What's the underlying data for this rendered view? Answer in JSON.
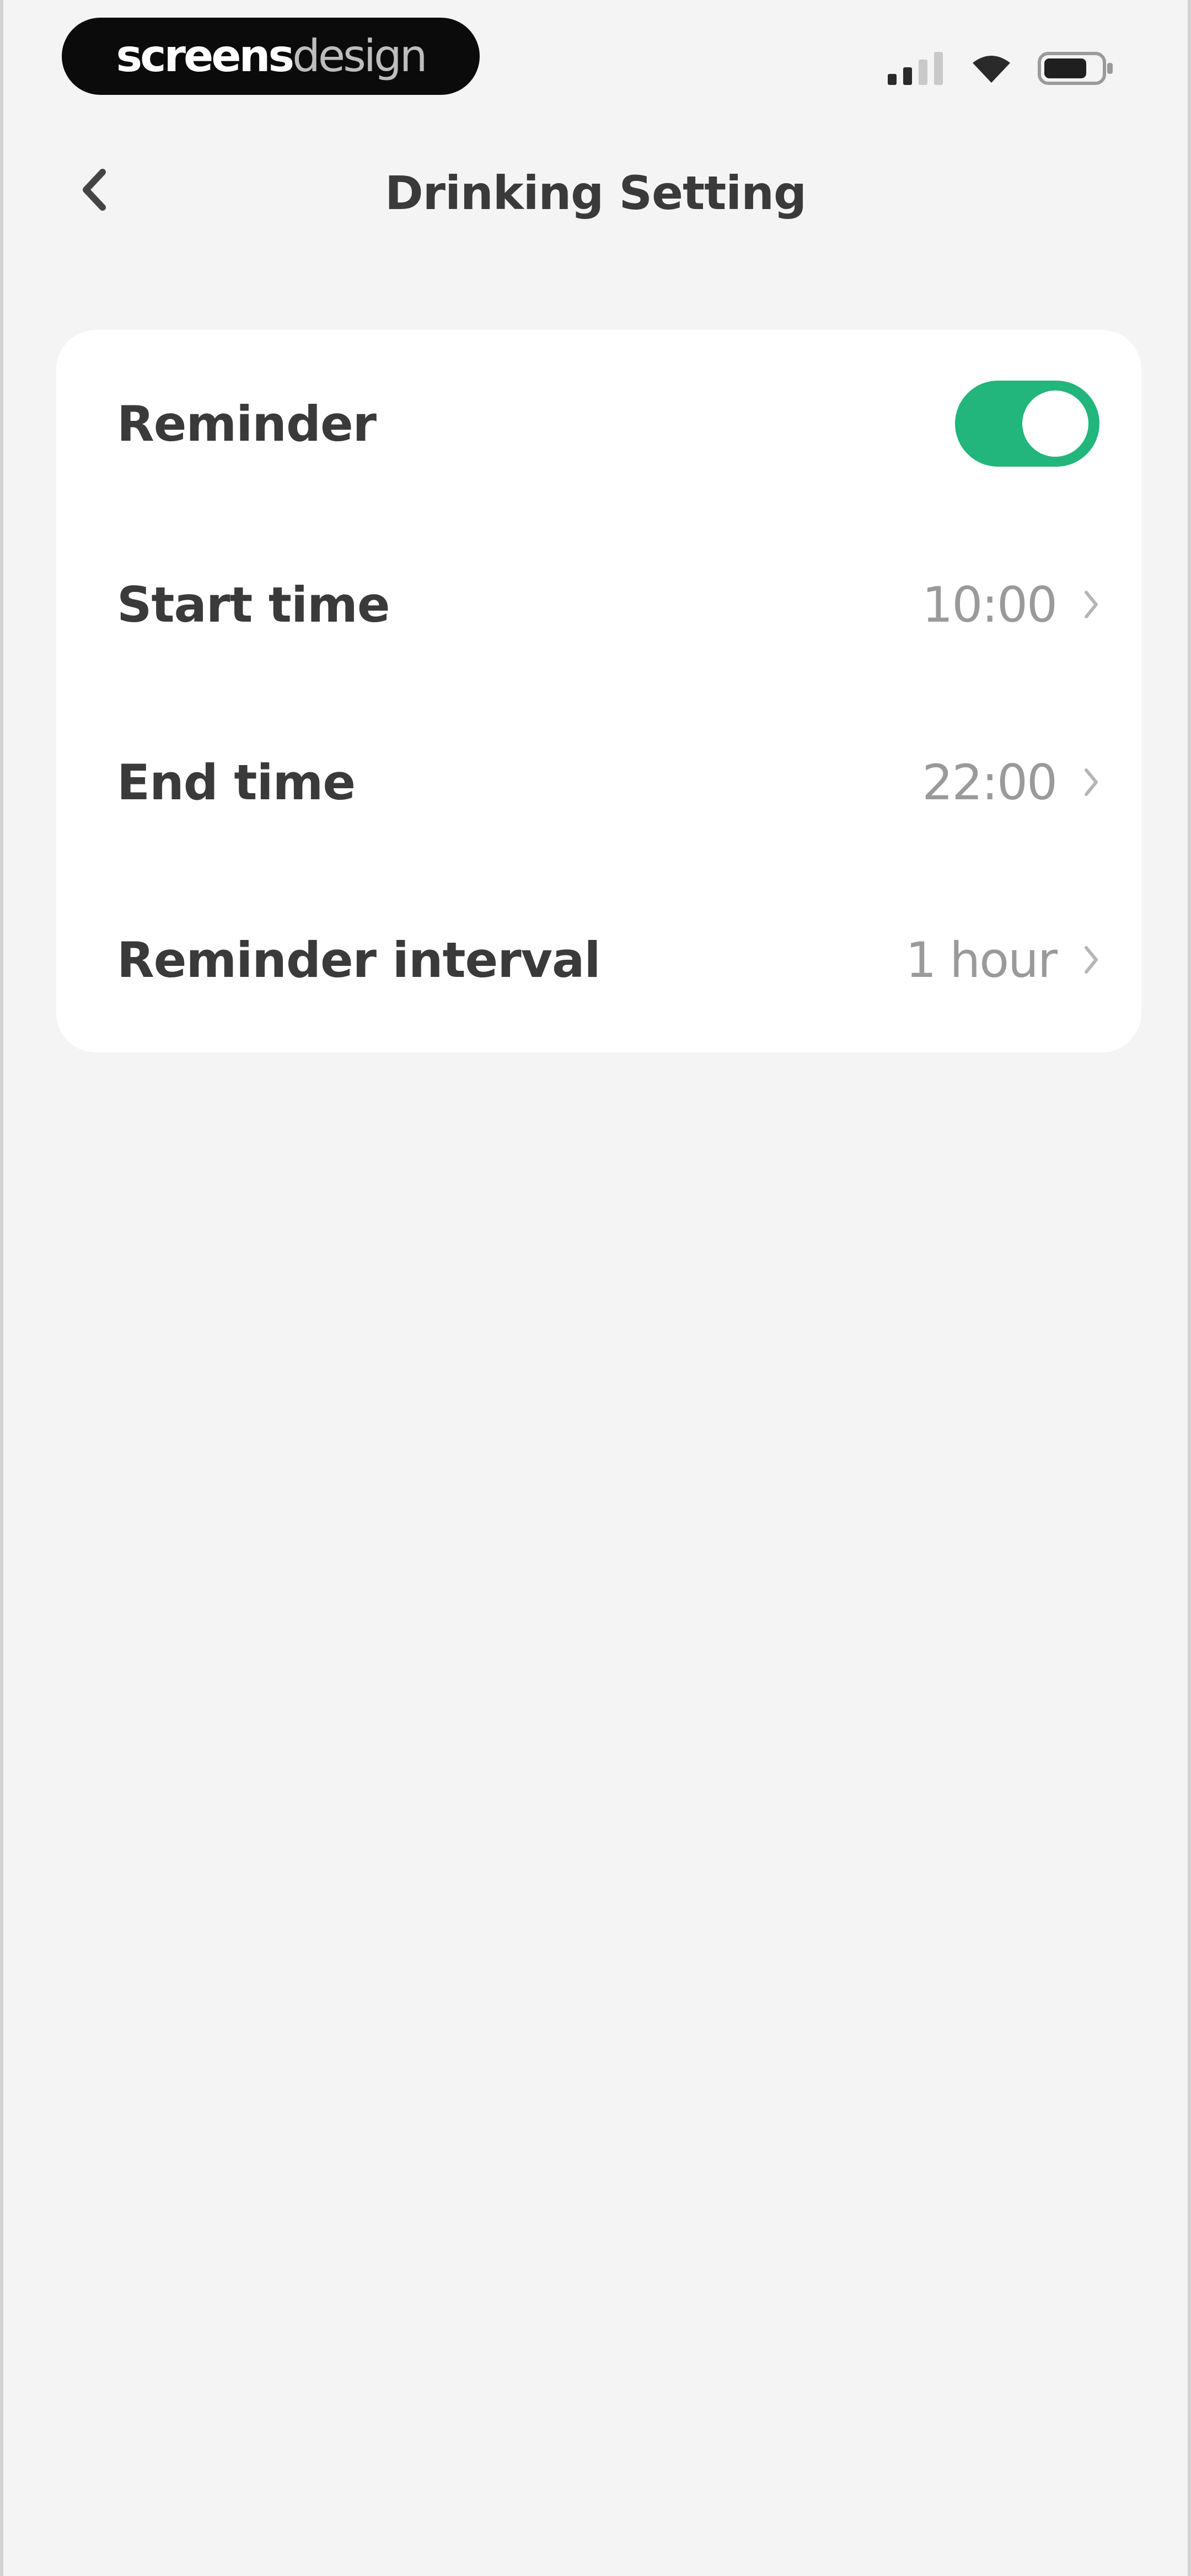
{
  "status_bar": {
    "brand_part1": "screens",
    "brand_part2": "design",
    "signal_icon": "signal-icon",
    "wifi_icon": "wifi-icon",
    "battery_icon": "battery-icon"
  },
  "nav": {
    "title": "Drinking Setting",
    "back_icon": "chevron-left-icon"
  },
  "settings": {
    "reminder": {
      "label": "Reminder",
      "enabled": true
    },
    "start_time": {
      "label": "Start time",
      "value": "10:00"
    },
    "end_time": {
      "label": "End time",
      "value": "22:00"
    },
    "interval": {
      "label": "Reminder interval",
      "value": "1 hour"
    }
  },
  "colors": {
    "accent": "#22b57c",
    "background": "#f4f4f4",
    "card": "#ffffff",
    "text_primary": "#3a3a3a",
    "text_secondary": "#9a9a9a"
  }
}
